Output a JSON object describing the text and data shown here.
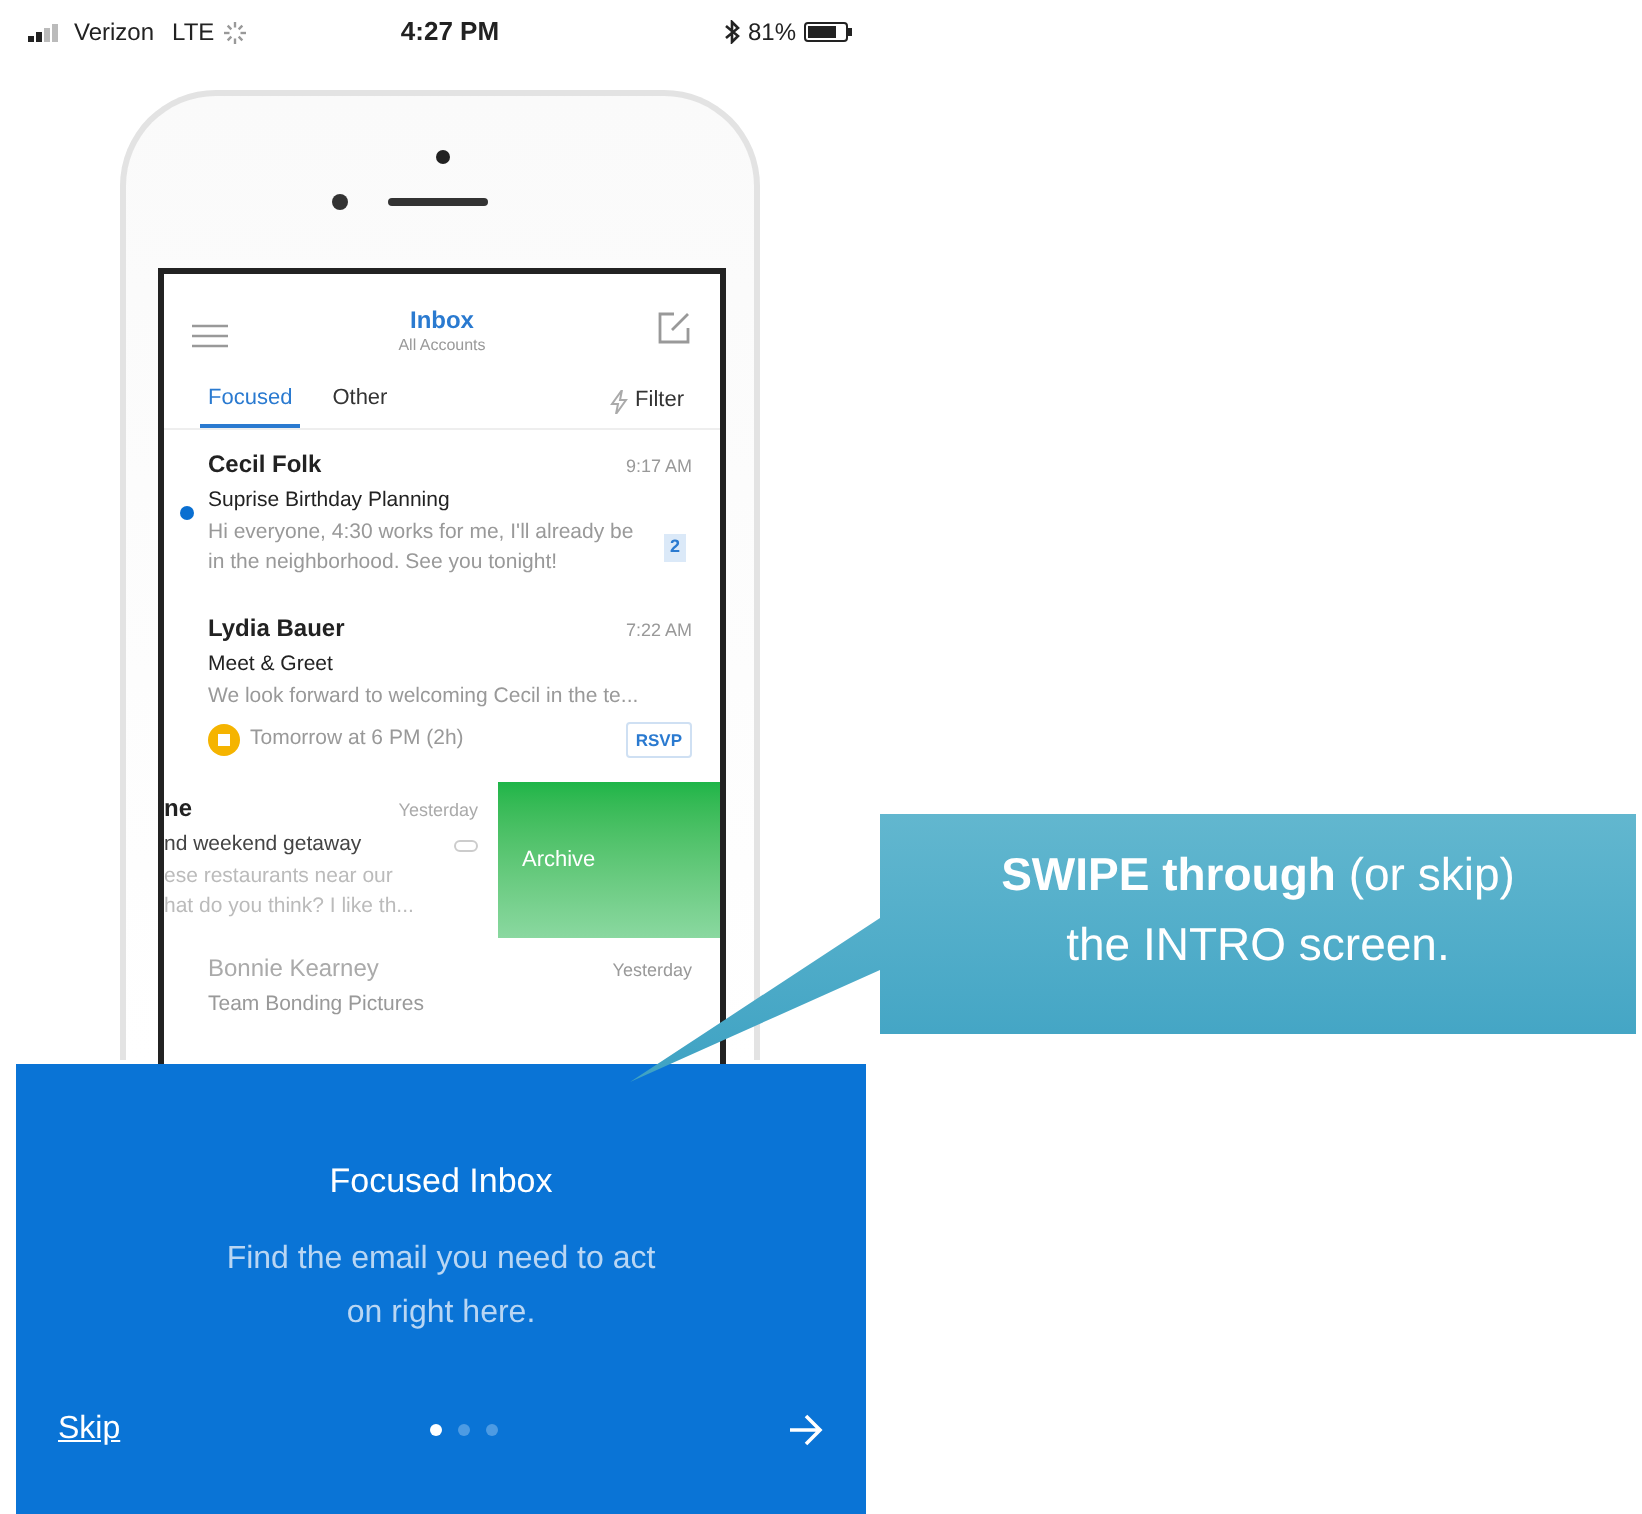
{
  "status_bar": {
    "carrier": "Verizon",
    "network": "LTE",
    "time": "4:27 PM",
    "battery": "81%"
  },
  "mail_app": {
    "title": "Inbox",
    "subtitle": "All Accounts",
    "tabs": [
      {
        "label": "Focused",
        "selected": true
      },
      {
        "label": "Other",
        "selected": false
      }
    ],
    "filter": "Filter",
    "messages": [
      {
        "kind": "normal",
        "sender": "Cecil Folk",
        "time": "9:17 AM",
        "subject": "Suprise Birthday Planning",
        "preview": "Hi everyone, 4:30 works for me, I'll already be in the neighborhood. See you tonight!",
        "unread": true,
        "count": "2"
      },
      {
        "kind": "event",
        "sender": "Lydia Bauer",
        "time": "7:22 AM",
        "subject": "Meet & Greet",
        "preview": "We look forward to welcoming Cecil in the te...",
        "event": "Tomorrow at 6 PM (2h)",
        "action": "RSVP",
        "unread": false
      },
      {
        "kind": "swiped",
        "sender": "ne",
        "time": "Yesterday",
        "subject": "nd weekend getaway",
        "preview": "ese restaurants near our\nhat do you think? I like th...",
        "swipe_action": "Archive"
      },
      {
        "kind": "faded",
        "sender": "Bonnie Kearney",
        "time": "Yesterday",
        "subject": "Team Bonding Pictures"
      }
    ]
  },
  "intro": {
    "title": "Focused Inbox",
    "body": "Find the email you need to act on right here.",
    "skip": "Skip",
    "pages": [
      {
        "selected": true
      },
      {
        "selected": false
      },
      {
        "selected": false
      }
    ]
  },
  "callout": {
    "text": "**SWIPE through** (or skip)\nthe INTRO screen."
  }
}
